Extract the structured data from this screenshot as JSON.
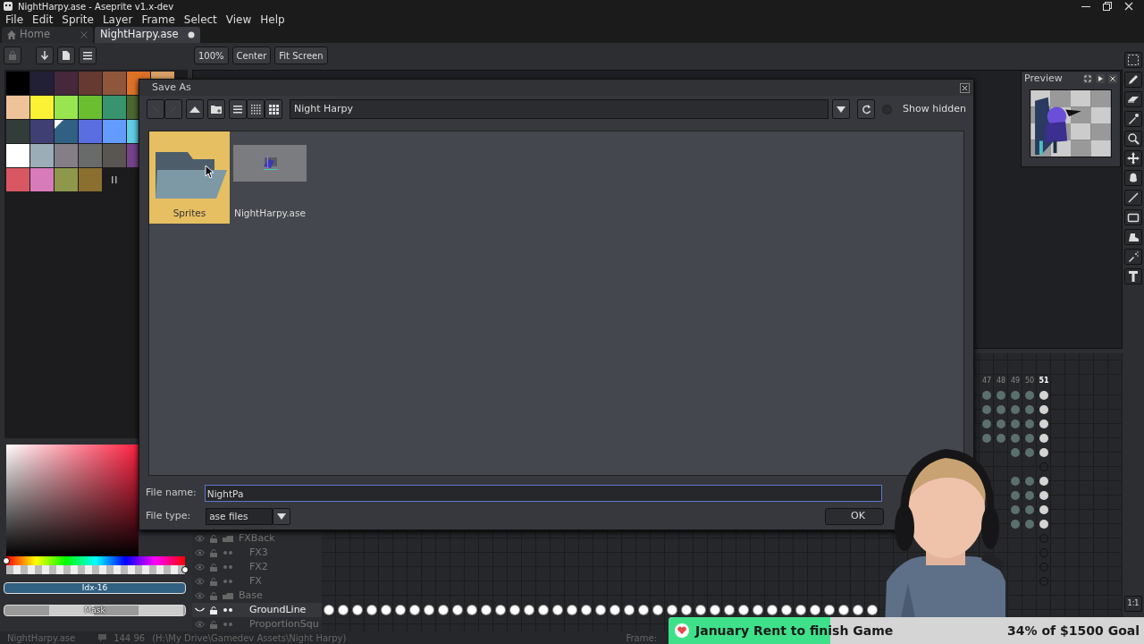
{
  "window": {
    "title": "NightHarpy.ase - Aseprite v1.x-dev"
  },
  "menu": [
    "File",
    "Edit",
    "Sprite",
    "Layer",
    "Frame",
    "Select",
    "View",
    "Help"
  ],
  "tabs": [
    {
      "label": "Home",
      "selected": false,
      "modified": false
    },
    {
      "label": "NightHarpy.ase",
      "selected": true,
      "modified": true
    }
  ],
  "zoom_buttons": [
    "100%",
    "Center",
    "Fit Screen"
  ],
  "palette": [
    [
      {
        "color": "#000000",
        "selected": false
      },
      {
        "color": "#222034",
        "selected": false
      },
      {
        "color": "#45283c",
        "selected": false
      },
      {
        "color": "#663931",
        "selected": false
      },
      {
        "color": "#8f563b",
        "selected": false
      },
      {
        "color": "#df7126",
        "selected": false
      },
      {
        "color": "#d9a066",
        "selected": false
      }
    ],
    [
      {
        "color": "#eec39a",
        "selected": false
      },
      {
        "color": "#fbf236",
        "selected": false
      },
      {
        "color": "#99e550",
        "selected": false
      },
      {
        "color": "#6abe30",
        "selected": false
      },
      {
        "color": "#37946e",
        "selected": false
      },
      {
        "color": "#4b692f",
        "selected": false
      }
    ],
    [
      {
        "color": "#323c39",
        "selected": false
      },
      {
        "color": "#3f3f74",
        "selected": false
      },
      {
        "color": "#306082",
        "selected": true
      },
      {
        "color": "#5b6ee1",
        "selected": false
      },
      {
        "color": "#639bff",
        "selected": false
      },
      {
        "color": "#5fcde4",
        "selected": false
      }
    ],
    [
      {
        "color": "#ffffff",
        "selected": false
      },
      {
        "color": "#9badb7",
        "selected": false
      },
      {
        "color": "#847e87",
        "selected": false
      },
      {
        "color": "#696a6a",
        "selected": false
      },
      {
        "color": "#595652",
        "selected": false
      },
      {
        "color": "#76428a",
        "selected": false
      }
    ],
    [
      {
        "color": "#d95763",
        "selected": false
      },
      {
        "color": "#d77bba",
        "selected": false
      },
      {
        "color": "#8f974a",
        "selected": false
      },
      {
        "color": "#8a6f30",
        "selected": false
      }
    ]
  ],
  "hue": {
    "level": 0
  },
  "alpha": {
    "level": 1
  },
  "color_index": "Idx-16",
  "mask": "Mask",
  "preview": {
    "title": "Preview"
  },
  "zoom_reset": "1:1",
  "timeline": {
    "frames": [
      {
        "label": "47",
        "selected": false
      },
      {
        "label": "48",
        "selected": false
      },
      {
        "label": "49",
        "selected": false
      },
      {
        "label": "50",
        "selected": false
      },
      {
        "label": "51",
        "selected": true
      }
    ],
    "layers": [
      {
        "cel": {
          "kind": "filled"
        },
        "last_cel": {
          "kind": "filled"
        },
        "selected": false
      },
      {
        "cel": {
          "kind": "filled"
        },
        "last_cel": {
          "kind": "filled"
        },
        "selected": false
      },
      {
        "cel": {
          "kind": "filled"
        },
        "last_cel": {
          "kind": "filled"
        },
        "selected": false
      },
      {
        "cel": {
          "kind": "filled"
        },
        "last_cel": {
          "kind": "filled"
        },
        "selected": false
      },
      {
        "cel": {
          "kind": "filled"
        },
        "last_cel": {
          "kind": "filled"
        },
        "selected": false
      },
      {
        "cel": {
          "kind": "empty"
        },
        "last_cel": {
          "kind": "hollow"
        },
        "selected": false
      },
      {
        "cel": {
          "kind": "filled"
        },
        "last_cel": {
          "kind": "filled"
        },
        "selected": false
      },
      {
        "cel": {
          "kind": "filled"
        },
        "last_cel": {
          "kind": "filled"
        },
        "selected": false
      },
      {
        "cel": {
          "kind": "filled"
        },
        "last_cel": {
          "kind": "filled"
        },
        "selected": false
      },
      {
        "cel": {
          "kind": "filled"
        },
        "last_cel": {
          "kind": "filled"
        },
        "selected": false
      },
      {
        "name": "FXBack",
        "kind": "group",
        "visible": true,
        "cel": {
          "kind": "empty"
        },
        "last_cel": {
          "kind": "hollow"
        },
        "selected": false
      },
      {
        "name": "FX3",
        "kind": "layer",
        "visible": true,
        "cel": {
          "kind": "empty"
        },
        "last_cel": {
          "kind": "hollow"
        },
        "selected": false
      },
      {
        "name": "FX2",
        "kind": "layer",
        "visible": true,
        "cel": {
          "kind": "empty"
        },
        "last_cel": {
          "kind": "hollow"
        },
        "selected": false
      },
      {
        "name": "FX",
        "kind": "layer",
        "visible": true,
        "cel": {
          "kind": "empty"
        },
        "last_cel": {
          "kind": "hollow"
        },
        "selected": false
      },
      {
        "name": "Base",
        "kind": "group",
        "visible": true,
        "cel": {
          "kind": "empty"
        },
        "selected": false
      },
      {
        "name": "GroundLine",
        "kind": "layer",
        "visible": false,
        "cel": {
          "kind": "filled"
        },
        "selected": true
      },
      {
        "name": "ProportionSqu",
        "kind": "layer",
        "visible": true,
        "selected": false
      }
    ]
  },
  "dialog": {
    "title": "Save As",
    "nav": [
      {
        "kind": "back",
        "disabled": true
      },
      {
        "kind": "forward",
        "disabled": true
      }
    ],
    "location": "Night Harpy",
    "show_hidden": {
      "label": "Show hidden",
      "checked": false
    },
    "files": [
      {
        "name": "Sprites",
        "kind": "folder",
        "selected": true
      },
      {
        "name": "NightHarpy.ase",
        "kind": "picture",
        "selected": false
      }
    ],
    "file_name": {
      "label": "File name:",
      "value": "NightPa"
    },
    "file_type": {
      "label": "File type:",
      "value": "ase files"
    },
    "ok": "OK"
  },
  "status_bar": {
    "file": "NightHarpy.ase",
    "size": "144 96",
    "path": "(H:\\My Drive\\Gamedev Assets\\Night Harpy)",
    "frame_label": "Frame:"
  },
  "goal": {
    "title": "January Rent to finish Game",
    "progress": "34% of $1500 Goal",
    "level": 0.34
  }
}
